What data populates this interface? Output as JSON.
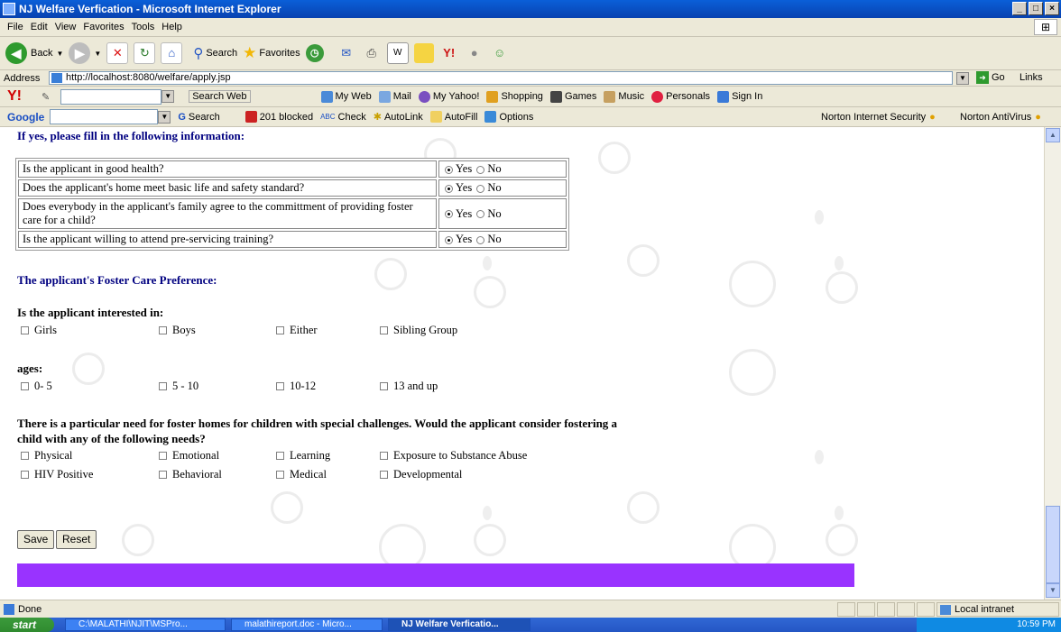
{
  "window": {
    "title": "NJ Welfare Verfication - Microsoft Internet Explorer",
    "controls": [
      "_",
      "□",
      "×"
    ]
  },
  "menu": [
    "File",
    "Edit",
    "View",
    "Favorites",
    "Tools",
    "Help"
  ],
  "toolbar": {
    "back": "Back",
    "search": "Search",
    "favorites": "Favorites"
  },
  "address": {
    "label": "Address",
    "url": "http://localhost:8080/welfare/apply.jsp",
    "go": "Go",
    "links": "Links"
  },
  "yahoo": {
    "logo": "Y!",
    "items": [
      "Search Web",
      "My Web",
      "Mail",
      "My Yahoo!",
      "Shopping",
      "Games",
      "Music",
      "Personals",
      "Sign In"
    ]
  },
  "google": {
    "logo": "Google",
    "items": [
      "Search",
      "201 blocked",
      "Check",
      "AutoLink",
      "AutoFill",
      "Options"
    ],
    "norton1": "Norton Internet Security",
    "norton2": "Norton AntiVirus"
  },
  "form": {
    "intro": "If yes, please fill in the following information:",
    "questions": [
      {
        "text": "Is the applicant in good health?",
        "yes": "Yes",
        "no": "No"
      },
      {
        "text": "Does the applicant's home meet basic life and safety standard?",
        "yes": "Yes",
        "no": "No"
      },
      {
        "text": "Does everybody in the applicant's family agree to the committment of providing foster care for a child?",
        "yes": "Yes",
        "no": "No"
      },
      {
        "text": "Is the applicant willing to attend pre-servicing training?",
        "yes": "Yes",
        "no": "No"
      }
    ],
    "preference_heading": "The applicant's Foster Care Preference:",
    "interested_label": "Is the applicant interested in:",
    "interested": [
      "Girls",
      "Boys",
      "Either",
      "Sibling Group"
    ],
    "ages_label": "ages:",
    "ages": [
      "0- 5",
      "5 - 10",
      "10-12",
      "13 and up"
    ],
    "needs_label": "There is a particular need for foster homes for children with special challenges. Would the applicant consider fostering a child with any of the following needs?",
    "needs": [
      "Physical",
      "Emotional",
      "Learning",
      "Exposure to Substance Abuse",
      "HIV Positive",
      "Behavioral",
      "Medical",
      "Developmental"
    ],
    "save": "Save",
    "reset": "Reset"
  },
  "status": {
    "text": "Done",
    "zone": "Local intranet"
  },
  "taskbar": {
    "start": "start",
    "tasks": [
      "C:\\MALATHI\\NJIT\\MSPro...",
      "malathireport.doc - Micro...",
      "NJ Welfare Verficatio..."
    ],
    "clock": "10:59 PM"
  }
}
